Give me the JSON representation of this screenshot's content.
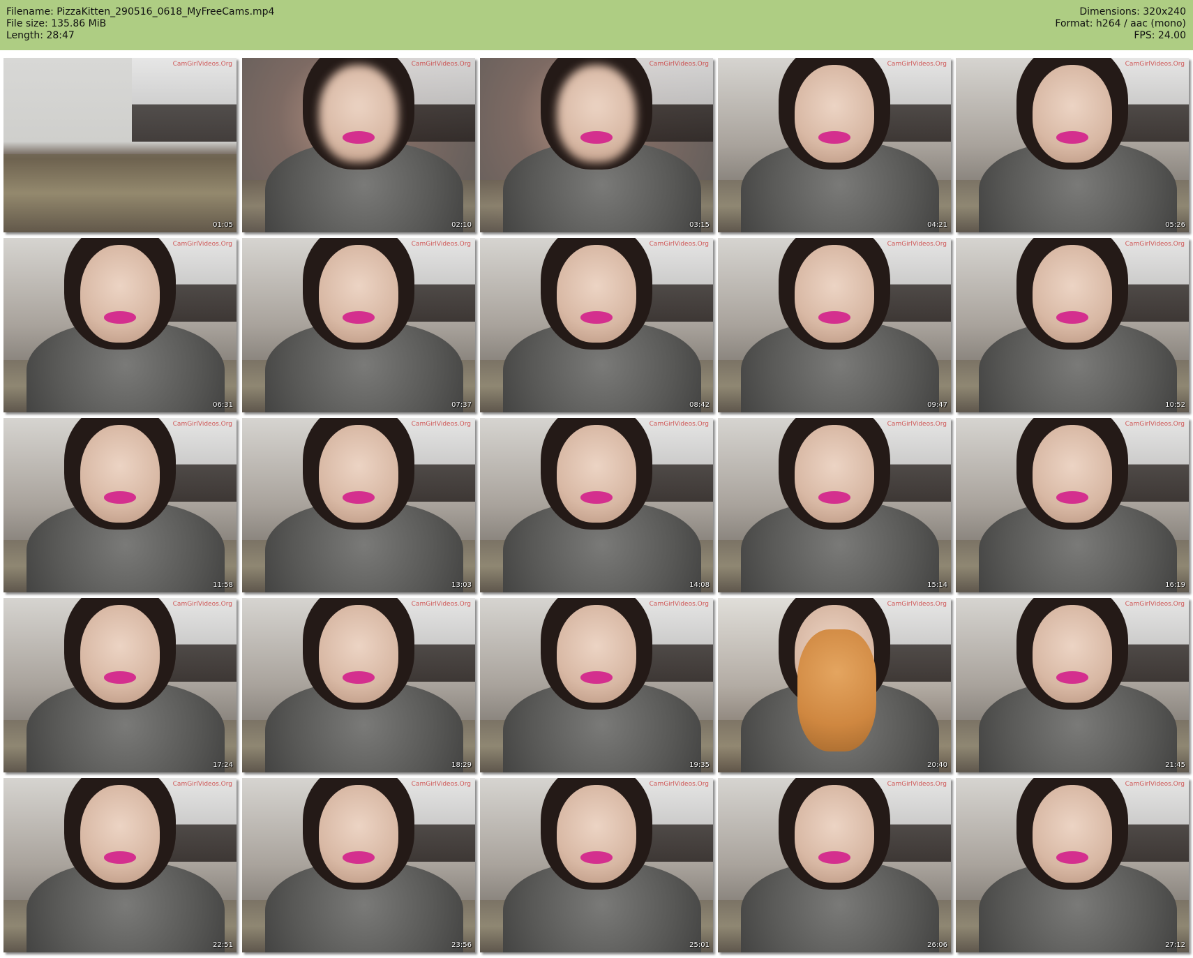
{
  "header": {
    "filename": "Filename: PizzaKitten_290516_0618_MyFreeCams.mp4",
    "filesize": "File size: 135.86 MiB",
    "length": "Length: 28:47",
    "dimensions": "Dimensions: 320x240",
    "format": "Format: h264 / aac (mono)",
    "fps": "FPS: 24.00"
  },
  "watermark": "CamGirlVideos.Org",
  "thumbnails": [
    {
      "time": "01:05",
      "scene": "room"
    },
    {
      "time": "02:10",
      "scene": "blur"
    },
    {
      "time": "03:15",
      "scene": "blur"
    },
    {
      "time": "04:21",
      "scene": "face"
    },
    {
      "time": "05:26",
      "scene": "face"
    },
    {
      "time": "06:31",
      "scene": "face"
    },
    {
      "time": "07:37",
      "scene": "face"
    },
    {
      "time": "08:42",
      "scene": "face"
    },
    {
      "time": "09:47",
      "scene": "face"
    },
    {
      "time": "10:52",
      "scene": "face"
    },
    {
      "time": "11:58",
      "scene": "face"
    },
    {
      "time": "13:03",
      "scene": "face"
    },
    {
      "time": "14:08",
      "scene": "face"
    },
    {
      "time": "15:14",
      "scene": "face"
    },
    {
      "time": "16:19",
      "scene": "face"
    },
    {
      "time": "17:24",
      "scene": "face"
    },
    {
      "time": "18:29",
      "scene": "face"
    },
    {
      "time": "19:35",
      "scene": "face"
    },
    {
      "time": "20:40",
      "scene": "cat"
    },
    {
      "time": "21:45",
      "scene": "face"
    },
    {
      "time": "22:51",
      "scene": "face"
    },
    {
      "time": "23:56",
      "scene": "face"
    },
    {
      "time": "25:01",
      "scene": "face"
    },
    {
      "time": "26:06",
      "scene": "face"
    },
    {
      "time": "27:12",
      "scene": "face"
    }
  ]
}
